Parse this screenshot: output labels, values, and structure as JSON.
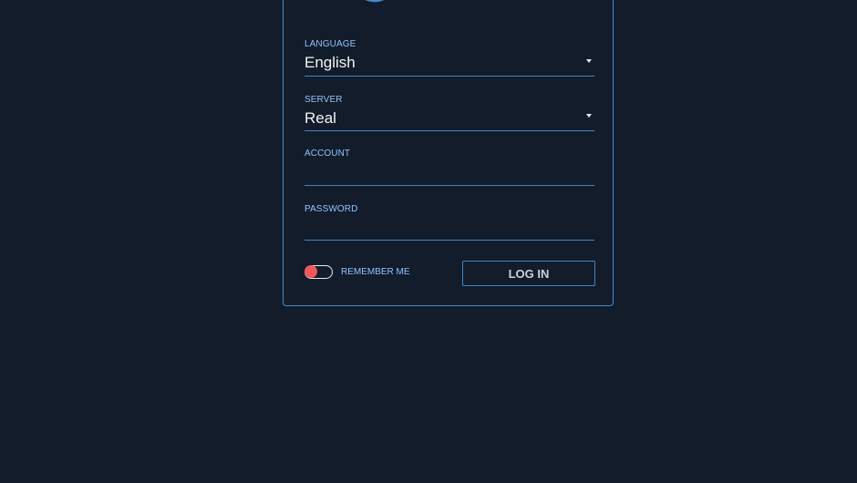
{
  "form": {
    "language": {
      "label": "LANGUAGE",
      "value": "English",
      "icon": "caret-down-icon"
    },
    "server": {
      "label": "SERVER",
      "value": "Real",
      "icon": "caret-down-icon"
    },
    "account": {
      "label": "ACCOUNT",
      "value": ""
    },
    "password": {
      "label": "PASSWORD",
      "value": ""
    },
    "remember_me": {
      "label": "REMEMBER ME",
      "enabled": false
    },
    "login_button_label": "LOG IN"
  },
  "colors": {
    "background": "#131c2a",
    "accent": "#3e86c9",
    "label": "#8fc4ff",
    "toggle_knob": "#ef5858"
  }
}
